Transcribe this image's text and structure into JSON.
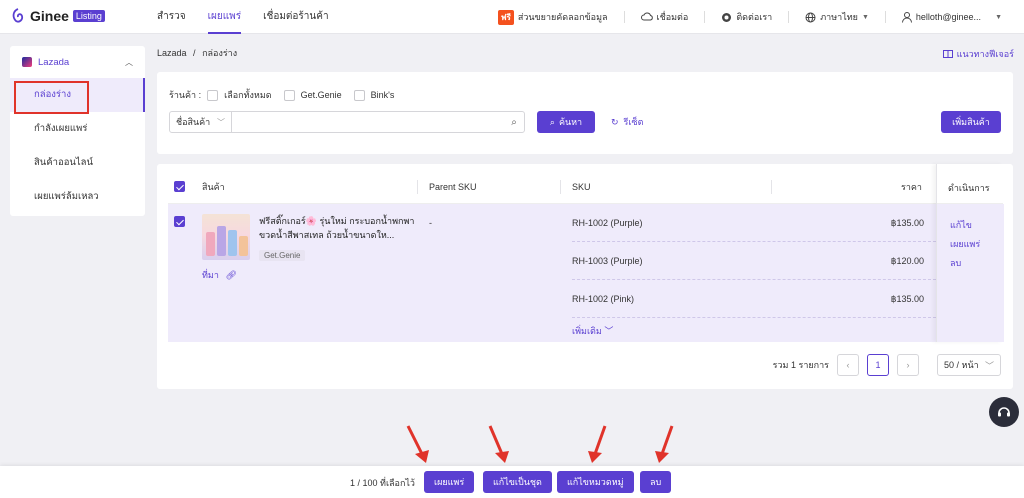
{
  "brand": {
    "name": "Ginee",
    "badge": "Listing"
  },
  "nav": [
    {
      "label": "สำรวจ"
    },
    {
      "label": "เผยแพร่",
      "active": true
    },
    {
      "label": "เชื่อมต่อร้านค้า"
    }
  ],
  "topright": {
    "free_badge": "ฟรี",
    "extension": "ส่วนขยายคัดลอกข้อมูล",
    "connect": "เชื่อมต่อ",
    "contact": "ติดต่อเรา",
    "language": "ภาษาไทย",
    "user": "helloth@ginee..."
  },
  "sidebar": {
    "platform": "Lazada",
    "items": [
      {
        "label": "กล่องร่าง",
        "active": true
      },
      {
        "label": "กำลังเผยแพร่"
      },
      {
        "label": "สินค้าออนไลน์"
      },
      {
        "label": "เผยแพร่ล้มเหลว"
      }
    ]
  },
  "breadcrumb": {
    "root": "Lazada",
    "sep": "/",
    "current": "กล่องร่าง"
  },
  "guide_link": "แนวทางฟีเจอร์",
  "filter": {
    "shop_label": "ร้านค้า :",
    "select_all": "เลือกทั้งหมด",
    "shops": [
      "Get.Genie",
      "Bink's"
    ],
    "field_select": "ชื่อสินค้า",
    "search_value": "",
    "search_button": "ค้นหา",
    "reset_button": "รีเซ็ต",
    "add_button": "เพิ่มสินค้า"
  },
  "table": {
    "headers": {
      "product": "สินค้า",
      "parent_sku": "Parent SKU",
      "sku": "SKU",
      "price": "ราคา",
      "actions": "ดำเนินการ"
    },
    "row": {
      "title": "ฟรีสติ๊กเกอร์🌸 รุ่นใหม่ กระบอกน้ำพกพา ขวดน้ำสีพาสเทล ถ้วยน้ำขนาดให...",
      "shop": "Get.Genie",
      "source": "ที่มา",
      "parent_sku": "-",
      "variants": [
        {
          "sku": "RH-1002 (Purple)",
          "price": "฿135.00"
        },
        {
          "sku": "RH-1003 (Purple)",
          "price": "฿120.00"
        },
        {
          "sku": "RH-1002 (Pink)",
          "price": "฿135.00"
        }
      ],
      "more": "เพิ่มเติม",
      "actions": [
        "แก้ไข",
        "เผยแพร่",
        "ลบ"
      ]
    }
  },
  "pagination": {
    "total": "รวม 1 รายการ",
    "current": "1",
    "page_size": "50 / หน้า"
  },
  "bottom_bar": {
    "selected": "1 / 100 ที่เลือกไว้",
    "buttons": [
      "เผยแพร่",
      "แก้ไขเป็นชุด",
      "แก้ไขหมวดหมู่",
      "ลบ"
    ]
  },
  "colors": {
    "accent": "#5a3fd1",
    "highlight": "#e0332a",
    "free": "#f4511e"
  }
}
